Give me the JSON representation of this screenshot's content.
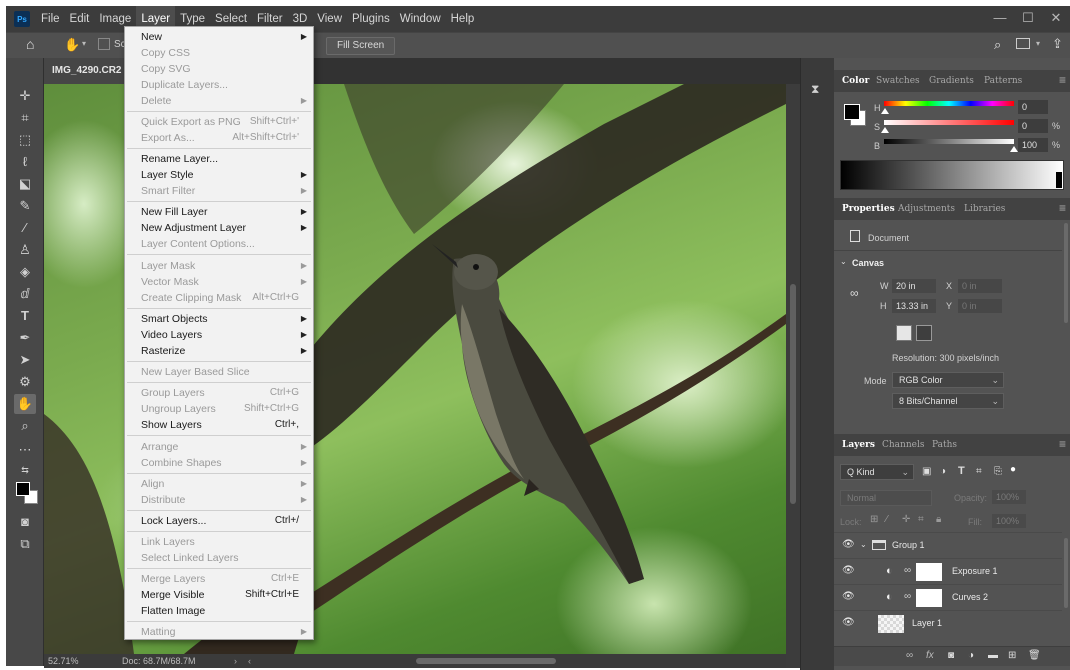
{
  "menubar": {
    "logo": "Ps",
    "items": [
      "File",
      "Edit",
      "Image",
      "Layer",
      "Type",
      "Select",
      "Filter",
      "3D",
      "View",
      "Plugins",
      "Window",
      "Help"
    ],
    "active": "Layer",
    "window_controls": {
      "minimize": "—",
      "maximize": "☐",
      "close": "✕"
    }
  },
  "options_bar": {
    "fill_screen_label": "Fill Screen",
    "partial_label": "Sc"
  },
  "document": {
    "tab_title": "IMG_4290.CR2 @",
    "zoom": "52.71%",
    "doc_size": "Doc: 68.7M/68.7M"
  },
  "layer_menu": {
    "items": [
      {
        "label": "New",
        "shortcut": "",
        "submenu": true,
        "disabled": false
      },
      {
        "label": "Copy CSS",
        "shortcut": "",
        "submenu": false,
        "disabled": true
      },
      {
        "label": "Copy SVG",
        "shortcut": "",
        "submenu": false,
        "disabled": true
      },
      {
        "label": "Duplicate Layers...",
        "shortcut": "",
        "submenu": false,
        "disabled": true
      },
      {
        "label": "Delete",
        "shortcut": "",
        "submenu": true,
        "disabled": true
      },
      {
        "label": "Quick Export as PNG",
        "shortcut": "Shift+Ctrl+'",
        "submenu": false,
        "disabled": true
      },
      {
        "label": "Export As...",
        "shortcut": "Alt+Shift+Ctrl+'",
        "submenu": false,
        "disabled": true
      },
      {
        "label": "Rename Layer...",
        "shortcut": "",
        "submenu": false,
        "disabled": false
      },
      {
        "label": "Layer Style",
        "shortcut": "",
        "submenu": true,
        "disabled": false
      },
      {
        "label": "Smart Filter",
        "shortcut": "",
        "submenu": true,
        "disabled": true
      },
      {
        "label": "New Fill Layer",
        "shortcut": "",
        "submenu": true,
        "disabled": false
      },
      {
        "label": "New Adjustment Layer",
        "shortcut": "",
        "submenu": true,
        "disabled": false
      },
      {
        "label": "Layer Content Options...",
        "shortcut": "",
        "submenu": false,
        "disabled": true
      },
      {
        "label": "Layer Mask",
        "shortcut": "",
        "submenu": true,
        "disabled": true
      },
      {
        "label": "Vector Mask",
        "shortcut": "",
        "submenu": true,
        "disabled": true
      },
      {
        "label": "Create Clipping Mask",
        "shortcut": "Alt+Ctrl+G",
        "submenu": false,
        "disabled": true
      },
      {
        "label": "Smart Objects",
        "shortcut": "",
        "submenu": true,
        "disabled": false
      },
      {
        "label": "Video Layers",
        "shortcut": "",
        "submenu": true,
        "disabled": false
      },
      {
        "label": "Rasterize",
        "shortcut": "",
        "submenu": true,
        "disabled": false
      },
      {
        "label": "New Layer Based Slice",
        "shortcut": "",
        "submenu": false,
        "disabled": true
      },
      {
        "label": "Group Layers",
        "shortcut": "Ctrl+G",
        "submenu": false,
        "disabled": true
      },
      {
        "label": "Ungroup Layers",
        "shortcut": "Shift+Ctrl+G",
        "submenu": false,
        "disabled": true
      },
      {
        "label": "Show Layers",
        "shortcut": "Ctrl+,",
        "submenu": false,
        "disabled": false
      },
      {
        "label": "Arrange",
        "shortcut": "",
        "submenu": true,
        "disabled": true
      },
      {
        "label": "Combine Shapes",
        "shortcut": "",
        "submenu": true,
        "disabled": true
      },
      {
        "label": "Align",
        "shortcut": "",
        "submenu": true,
        "disabled": true
      },
      {
        "label": "Distribute",
        "shortcut": "",
        "submenu": true,
        "disabled": true
      },
      {
        "label": "Lock Layers...",
        "shortcut": "Ctrl+/",
        "submenu": false,
        "disabled": false
      },
      {
        "label": "Link Layers",
        "shortcut": "",
        "submenu": false,
        "disabled": true
      },
      {
        "label": "Select Linked Layers",
        "shortcut": "",
        "submenu": false,
        "disabled": true
      },
      {
        "label": "Merge Layers",
        "shortcut": "Ctrl+E",
        "submenu": false,
        "disabled": true
      },
      {
        "label": "Merge Visible",
        "shortcut": "Shift+Ctrl+E",
        "submenu": false,
        "disabled": false
      },
      {
        "label": "Flatten Image",
        "shortcut": "",
        "submenu": false,
        "disabled": false
      },
      {
        "label": "Matting",
        "shortcut": "",
        "submenu": true,
        "disabled": true
      }
    ]
  },
  "color_panel": {
    "tabs": [
      "Color",
      "Swatches",
      "Gradients",
      "Patterns"
    ],
    "active_tab": "Color",
    "h": {
      "label": "H",
      "value": "0",
      "unit": ""
    },
    "s": {
      "label": "S",
      "value": "0",
      "unit": "%"
    },
    "b": {
      "label": "B",
      "value": "100",
      "unit": "%"
    },
    "foreground": "#000000",
    "background": "#ffffff"
  },
  "properties_panel": {
    "tabs": [
      "Properties",
      "Adjustments",
      "Libraries"
    ],
    "active_tab": "Properties",
    "document_label": "Document",
    "canvas_section": "Canvas",
    "w_label": "W",
    "w_value": "20 in",
    "h_label": "H",
    "h_value": "13.33 in",
    "x_label": "X",
    "x_value": "0 in",
    "y_label": "Y",
    "y_value": "0 in",
    "resolution": "Resolution: 300 pixels/inch",
    "mode_label": "Mode",
    "mode_value": "RGB Color",
    "depth_value": "8 Bits/Channel"
  },
  "layers_panel": {
    "tabs": [
      "Layers",
      "Channels",
      "Paths"
    ],
    "active_tab": "Layers",
    "filter_kind": "Q Kind",
    "blend_mode": "Normal",
    "opacity_label": "Opacity:",
    "opacity_value": "100%",
    "lock_label": "Lock:",
    "fill_label": "Fill:",
    "fill_value": "100%",
    "layers": [
      {
        "name": "Group 1",
        "type": "group"
      },
      {
        "name": "Exposure 1",
        "type": "adjustment"
      },
      {
        "name": "Curves 2",
        "type": "adjustment"
      },
      {
        "name": "Layer 1",
        "type": "pixel"
      }
    ]
  }
}
